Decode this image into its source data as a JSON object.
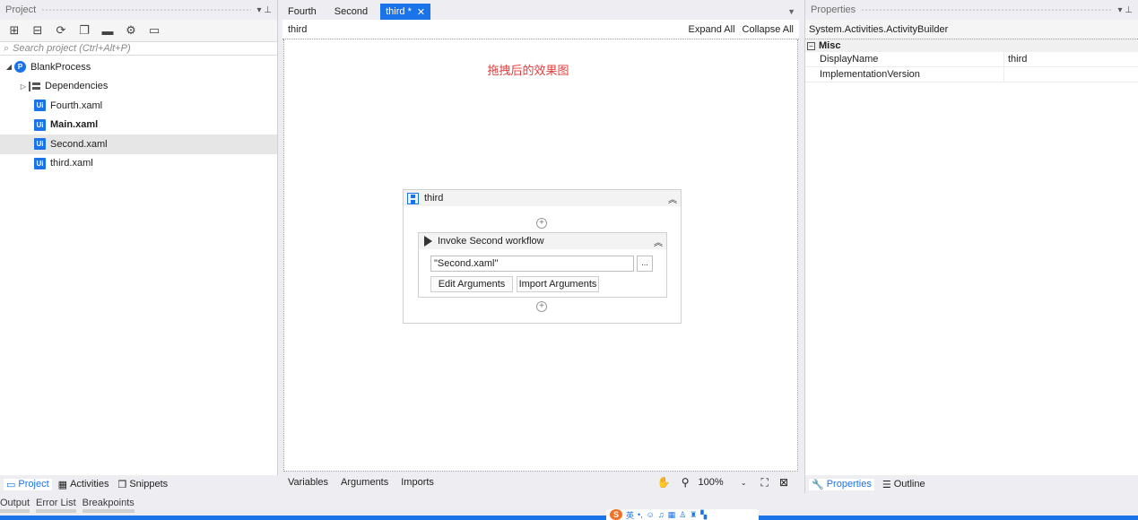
{
  "left_panel": {
    "title": "Project",
    "pin": "▾ ⊥",
    "search_placeholder": "Search project (Ctrl+Alt+P)",
    "tree": [
      {
        "label": "BlankProcess",
        "icon": "process-icon"
      },
      {
        "label": "Dependencies",
        "icon": "dependencies-icon"
      },
      {
        "label": "Fourth.xaml",
        "icon": "ui-file-icon"
      },
      {
        "label": "Main.xaml",
        "icon": "ui-file-icon"
      },
      {
        "label": "Second.xaml",
        "icon": "ui-file-icon"
      },
      {
        "label": "third.xaml",
        "icon": "ui-file-icon"
      }
    ],
    "tabs": [
      "Project",
      "Activities",
      "Snippets"
    ]
  },
  "doc_tabs": [
    "Fourth",
    "Second",
    "third *"
  ],
  "breadcrumb": {
    "current": "third",
    "expand_all": "Expand All",
    "collapse_all": "Collapse All"
  },
  "canvas": {
    "note": "拖拽后的效果图",
    "sequence_title": "third",
    "invoke_title": "Invoke Second workflow",
    "file_path": "\"Second.xaml\"",
    "browse_label": "...",
    "edit_args": "Edit Arguments",
    "import_args": "Import Arguments"
  },
  "center_bottom": {
    "tabs": [
      "Variables",
      "Arguments",
      "Imports"
    ],
    "zoom": "100%"
  },
  "properties": {
    "title": "Properties",
    "type": "System.Activities.ActivityBuilder",
    "category": "Misc",
    "rows": [
      {
        "name": "DisplayName",
        "value": "third"
      },
      {
        "name": "ImplementationVersion",
        "value": ""
      }
    ],
    "tabs": [
      "Properties",
      "Outline"
    ]
  },
  "bottom_tabs": [
    "Output",
    "Error List",
    "Breakpoints"
  ],
  "ime": {
    "lang": "英"
  },
  "colors": {
    "accent": "#1a73e8",
    "note": "#e23b3b"
  }
}
